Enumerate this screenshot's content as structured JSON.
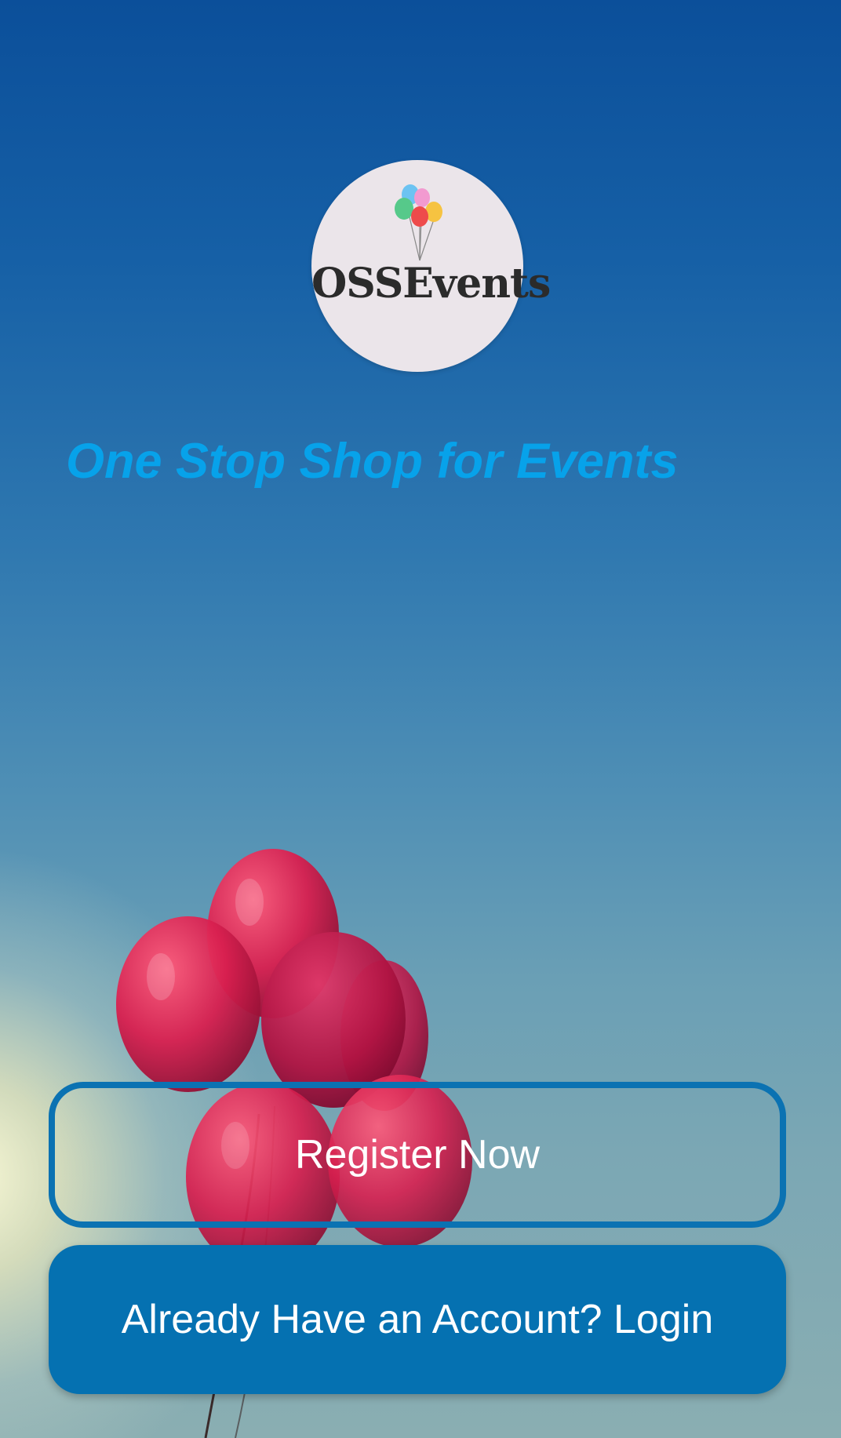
{
  "logo": {
    "text": "OSSEvents",
    "icon": "balloon-bunch-icon"
  },
  "tagline": "One Stop Shop for Events",
  "buttons": {
    "register_label": "Register Now",
    "login_label": "Already Have an Account? Login"
  },
  "colors": {
    "tagline": "#07a2ea",
    "primary_button": "#0571b1",
    "outline_button_border": "#0b72b2",
    "button_text": "#ffffff"
  },
  "background": {
    "image": "red-balloons-against-blue-sky"
  }
}
